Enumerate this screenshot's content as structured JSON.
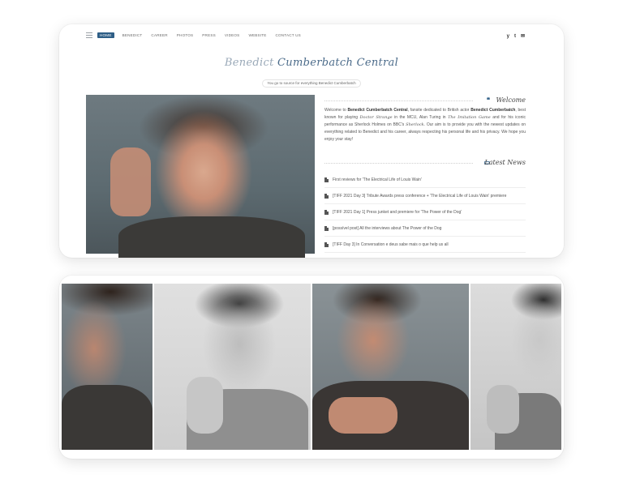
{
  "nav": {
    "items": [
      "Home",
      "Benedict",
      "Career",
      "Photos",
      "Press",
      "Videos",
      "Website",
      "Contact us"
    ],
    "social_icons": [
      "twitter-icon",
      "tumblr-icon",
      "mail-icon"
    ],
    "social_glyphs": [
      "y",
      "t",
      "✉"
    ]
  },
  "header": {
    "title_part1": "Benedict ",
    "title_part2": "Cumberbatch Central",
    "tagline": "You go to source for everything Benedict Cumberbatch"
  },
  "welcome": {
    "icon": "❝",
    "heading": "Welcome",
    "text": {
      "p1": "Welcome to ",
      "site": "Benedict Cumberbatch Central",
      "p2": ", fansite dedicated to British actor ",
      "actor": "Benedict Cumberbatch",
      "p3": ", best known for playing ",
      "role1": "Doctor Strange",
      "p4": " in the MCU, Alan Turing in ",
      "film1": "The Imitation Game",
      "p5": " and for his iconic performance as Sherlock Holmes on BBC's ",
      "show1": "Sherlock",
      "p6": ". Our aim is to provide you with the newest updates on everything related to Benedict and his career, always respecting his personal life and his privacy. We hope you enjoy your stay!"
    }
  },
  "news": {
    "icon": "▭",
    "heading": "Latest News",
    "items": [
      "First reviews for 'The Electrical Life of Louis Wain'",
      "[TIFF 2021 Day 3] Tribute Awards press conference + 'The Electrical Life of Louis Wain' premiere",
      "[TIFF 2021 Day 1] Press junket and premiere for 'The Power of the Dog'",
      "[possível post] All the interviews about The Power of the Dog",
      "[TIFF Day 3] In Conversation e deus sabe mais o que help us all"
    ]
  },
  "colors": {
    "accent": "#2e5e86",
    "title_light": "#9aa9b8",
    "title_dark": "#4b6b8a"
  }
}
